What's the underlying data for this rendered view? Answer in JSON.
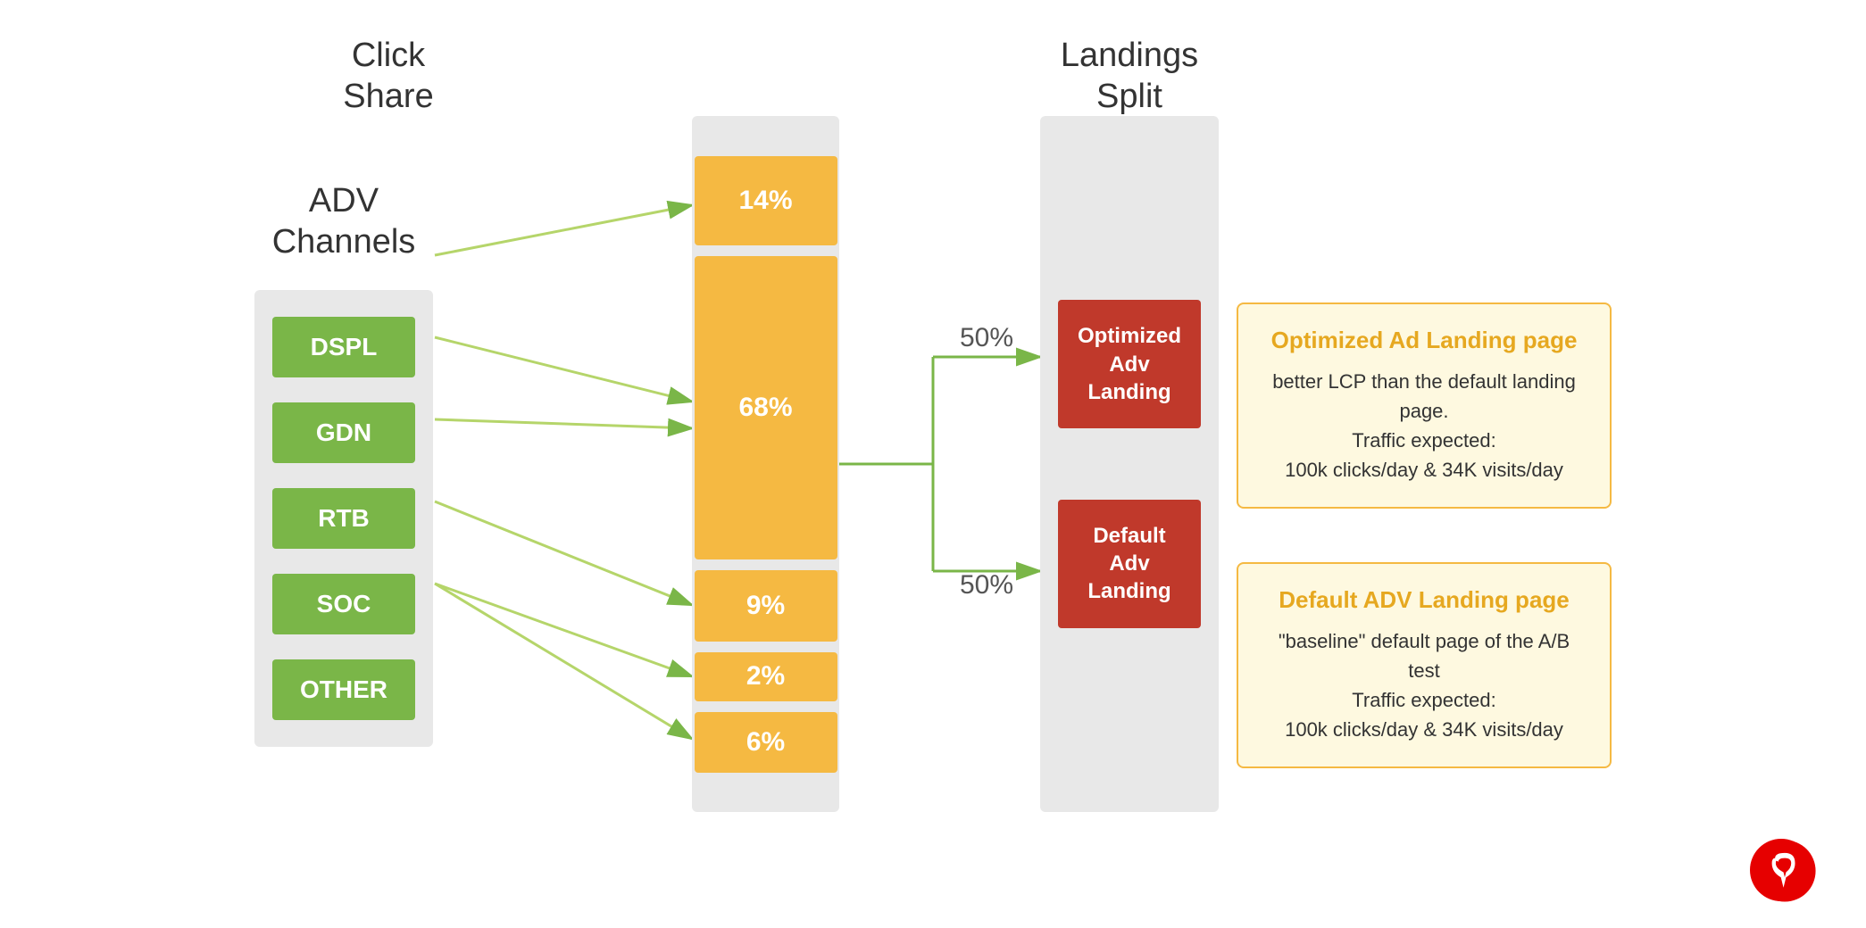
{
  "header": {
    "adv_channels": "ADV\nChannels",
    "click_share": "Click\nShare",
    "landings_split": "Landings\nSplit"
  },
  "channels": [
    {
      "label": "DSPL"
    },
    {
      "label": "GDN"
    },
    {
      "label": "RTB"
    },
    {
      "label": "SOC"
    },
    {
      "label": "OTHER"
    }
  ],
  "click_shares": [
    {
      "value": "14%",
      "size": "small14"
    },
    {
      "value": "68%",
      "size": "large"
    },
    {
      "value": "9%",
      "size": "small9"
    },
    {
      "value": "2%",
      "size": "small2"
    },
    {
      "value": "6%",
      "size": "small6"
    }
  ],
  "split_labels": [
    {
      "value": "50%"
    },
    {
      "value": "50%"
    }
  ],
  "landings": [
    {
      "label": "Optimized\nAdv\nLanding"
    },
    {
      "label": "Default\nAdv\nLanding"
    }
  ],
  "info_cards": [
    {
      "title": "Optimized Ad Landing page",
      "body": "better LCP than the default landing page.\nTraffic expected:\n100k clicks/day  & 34K visits/day"
    },
    {
      "title": "Default ADV Landing page",
      "body": "\"baseline\" default page of the A/B test\nTraffic expected:\n100k clicks/day  & 34K visits/day"
    }
  ]
}
